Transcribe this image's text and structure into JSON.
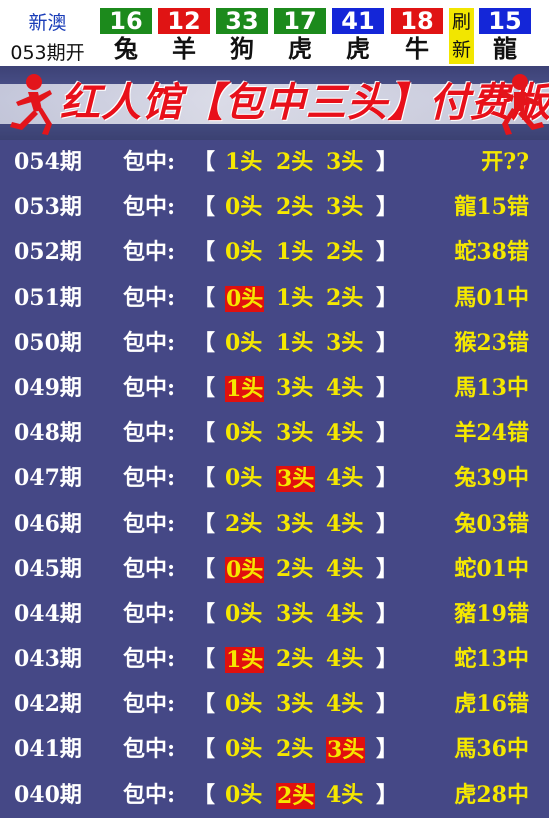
{
  "header": {
    "label_top": "新澳",
    "label_bottom": "053期开",
    "balls": [
      {
        "num": "16",
        "zodiac": "兔",
        "color": "#1c8a1c"
      },
      {
        "num": "12",
        "zodiac": "羊",
        "color": "#e01414"
      },
      {
        "num": "33",
        "zodiac": "狗",
        "color": "#1c8a1c"
      },
      {
        "num": "17",
        "zodiac": "虎",
        "color": "#1c8a1c"
      },
      {
        "num": "41",
        "zodiac": "虎",
        "color": "#1426d8"
      },
      {
        "num": "18",
        "zodiac": "牛",
        "color": "#e01414"
      }
    ],
    "flag_top": "刷",
    "flag_bottom": "新",
    "special": {
      "num": "15",
      "zodiac": "龍",
      "color": "#1426d8"
    }
  },
  "banner": {
    "title": "红人馆【包中三头】付费版"
  },
  "colors": {
    "list_bg": "#454886",
    "highlight_text": "#f5e800",
    "hit_bg": "#e0100e"
  },
  "rows": [
    {
      "period": "054期",
      "prefix": "包中:",
      "lb": "【",
      "h": [
        "1头",
        "2头",
        "3头"
      ],
      "rb": "】",
      "hit": -1,
      "result": "开??"
    },
    {
      "period": "053期",
      "prefix": "包中:",
      "lb": "【",
      "h": [
        "0头",
        "2头",
        "3头"
      ],
      "rb": "】",
      "hit": -1,
      "result": "龍15错"
    },
    {
      "period": "052期",
      "prefix": "包中:",
      "lb": "【",
      "h": [
        "0头",
        "1头",
        "2头"
      ],
      "rb": "】",
      "hit": -1,
      "result": "蛇38错"
    },
    {
      "period": "051期",
      "prefix": "包中:",
      "lb": "【",
      "h": [
        "0头",
        "1头",
        "2头"
      ],
      "rb": "】",
      "hit": 0,
      "result": "馬01中"
    },
    {
      "period": "050期",
      "prefix": "包中:",
      "lb": "【",
      "h": [
        "0头",
        "1头",
        "3头"
      ],
      "rb": "】",
      "hit": -1,
      "result": "猴23错"
    },
    {
      "period": "049期",
      "prefix": "包中:",
      "lb": "【",
      "h": [
        "1头",
        "3头",
        "4头"
      ],
      "rb": "】",
      "hit": 0,
      "result": "馬13中"
    },
    {
      "period": "048期",
      "prefix": "包中:",
      "lb": "【",
      "h": [
        "0头",
        "3头",
        "4头"
      ],
      "rb": "】",
      "hit": -1,
      "result": "羊24错"
    },
    {
      "period": "047期",
      "prefix": "包中:",
      "lb": "【",
      "h": [
        "0头",
        "3头",
        "4头"
      ],
      "rb": "】",
      "hit": 1,
      "result": "兔39中"
    },
    {
      "period": "046期",
      "prefix": "包中:",
      "lb": "【",
      "h": [
        "2头",
        "3头",
        "4头"
      ],
      "rb": "】",
      "hit": -1,
      "result": "兔03错"
    },
    {
      "period": "045期",
      "prefix": "包中:",
      "lb": "【",
      "h": [
        "0头",
        "2头",
        "4头"
      ],
      "rb": "】",
      "hit": 0,
      "result": "蛇01中"
    },
    {
      "period": "044期",
      "prefix": "包中:",
      "lb": "【",
      "h": [
        "0头",
        "3头",
        "4头"
      ],
      "rb": "】",
      "hit": -1,
      "result": "豬19错"
    },
    {
      "period": "043期",
      "prefix": "包中:",
      "lb": "【",
      "h": [
        "1头",
        "2头",
        "4头"
      ],
      "rb": "】",
      "hit": 0,
      "result": "蛇13中"
    },
    {
      "period": "042期",
      "prefix": "包中:",
      "lb": "【",
      "h": [
        "0头",
        "3头",
        "4头"
      ],
      "rb": "】",
      "hit": -1,
      "result": "虎16错"
    },
    {
      "period": "041期",
      "prefix": "包中:",
      "lb": "【",
      "h": [
        "0头",
        "2头",
        "3头"
      ],
      "rb": "】",
      "hit": 2,
      "result": "馬36中"
    },
    {
      "period": "040期",
      "prefix": "包中:",
      "lb": "【",
      "h": [
        "0头",
        "2头",
        "4头"
      ],
      "rb": "】",
      "hit": 1,
      "result": "虎28中"
    }
  ]
}
